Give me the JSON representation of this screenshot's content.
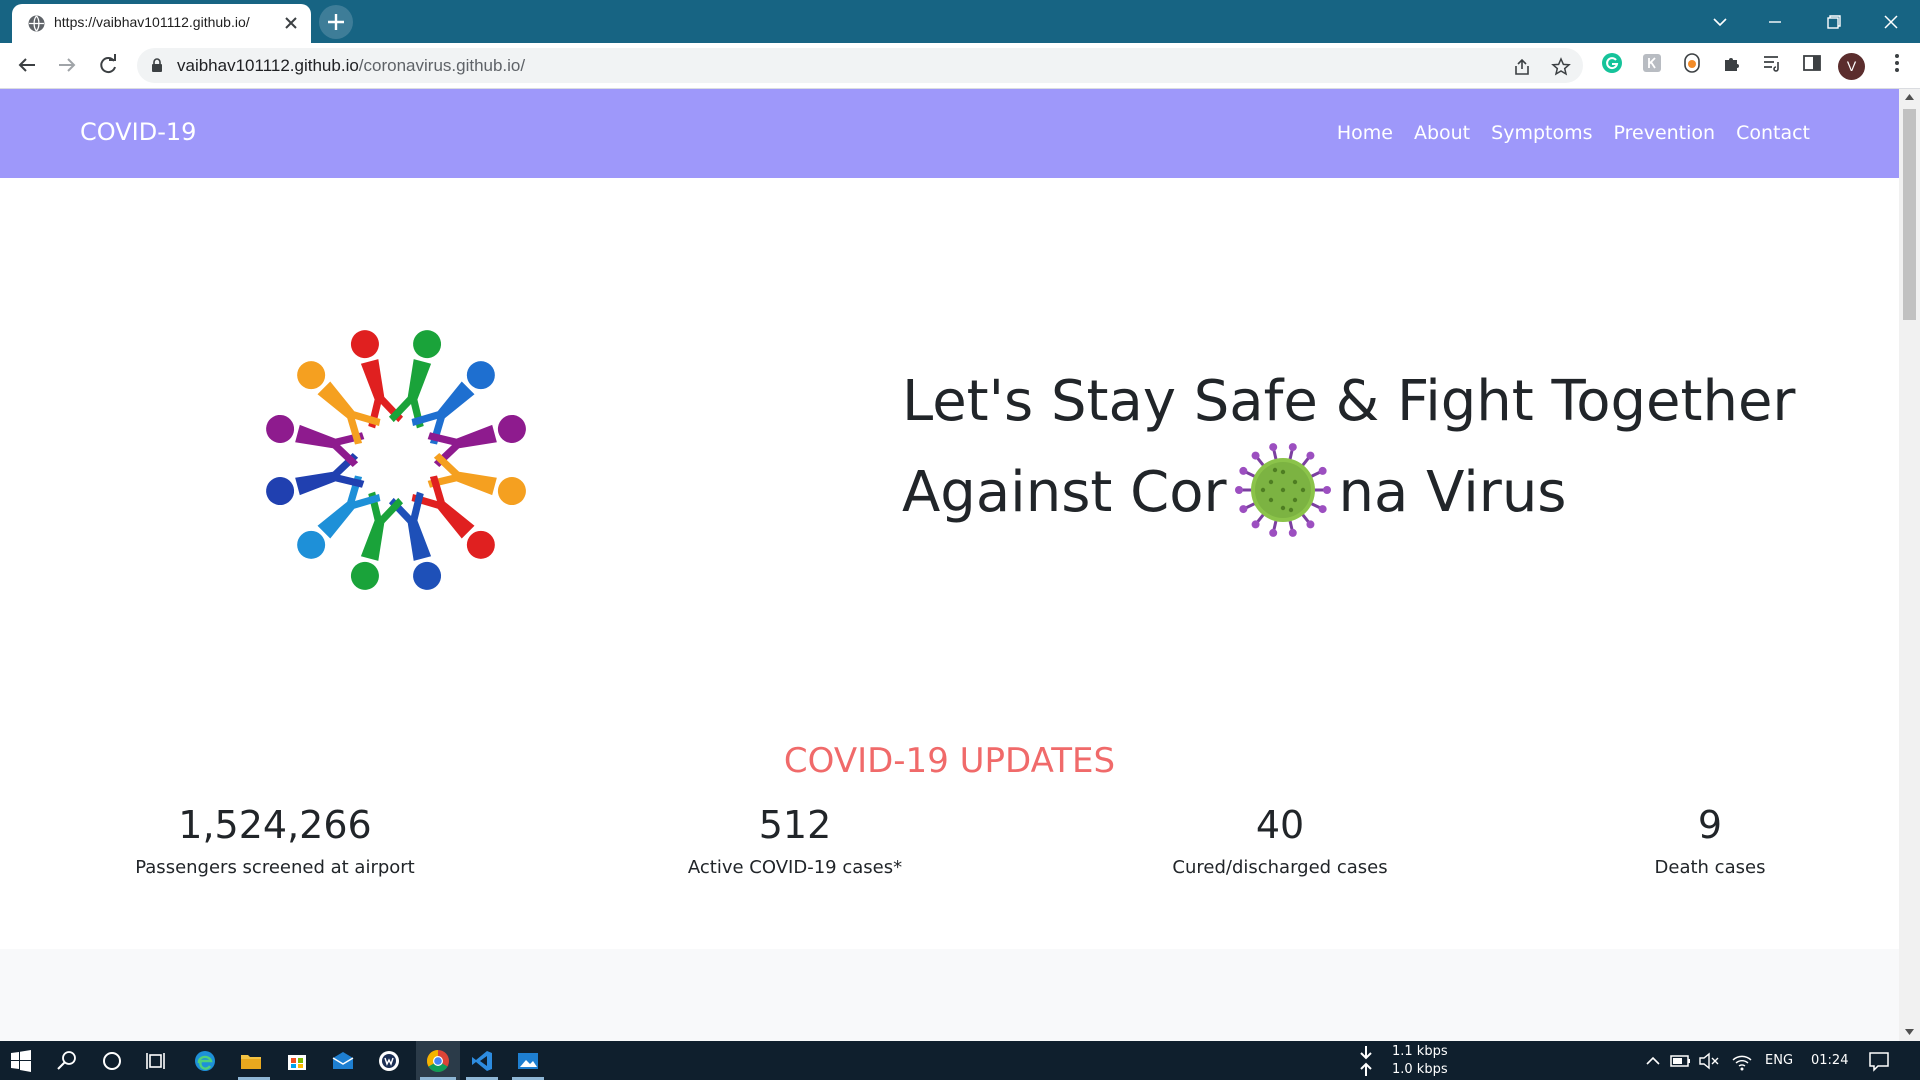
{
  "browser": {
    "tab_title": "https://vaibhav101112.github.io/",
    "url_host": "vaibhav101112.github.io",
    "url_path": "/coronavirus.github.io/",
    "profile_initial": "V"
  },
  "site": {
    "brand": "COVID-19",
    "nav": [
      "Home",
      "About",
      "Symptoms",
      "Prevention",
      "Contact"
    ],
    "hero_line1": "Let's Stay Safe & Fight Together",
    "hero_line2_a": "Against Cor",
    "hero_line2_b": "na Virus",
    "updates_title": "COVID-19 UPDATES",
    "stats": [
      {
        "value": "1,524,266",
        "label": "Passengers screened at airport"
      },
      {
        "value": "512",
        "label": "Active COVID-19 cases*"
      },
      {
        "value": "40",
        "label": "Cured/discharged cases"
      },
      {
        "value": "9",
        "label": "Death cases"
      }
    ]
  },
  "taskbar": {
    "net_down": "1.1 kbps",
    "net_up": "1.0 kbps",
    "lang": "ENG",
    "time": "01:24"
  },
  "colors": {
    "titlebar": "#176483",
    "navbar": "#9e98fa",
    "updates_title": "#f06a6a",
    "taskbar": "#0f1f2d"
  }
}
